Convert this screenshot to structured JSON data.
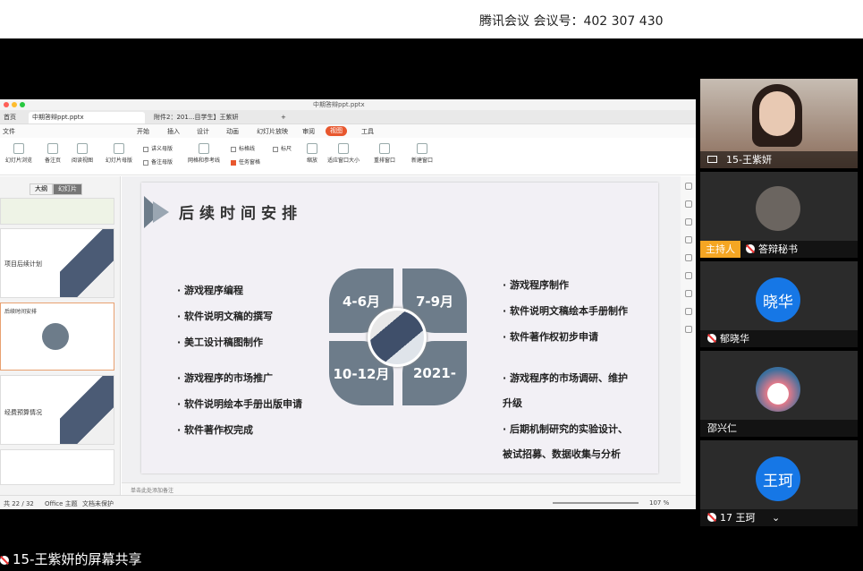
{
  "meeting": {
    "info": "腾讯会议 会议号：402 307 430"
  },
  "window": {
    "filename": "中期答辩ppt.pptx"
  },
  "tabs": [
    {
      "label": "首页"
    },
    {
      "label": "中期答辩ppt.pptx"
    },
    {
      "label": "附件2：201...目学生】王紫妍"
    }
  ],
  "menus": [
    "文件",
    "开始",
    "插入",
    "设计",
    "动画",
    "幻灯片放映",
    "审阅",
    "视图",
    "工具"
  ],
  "ribbon": {
    "buttons": [
      "幻灯片浏览",
      "备注页",
      "阅读视图",
      "幻灯片母版",
      "网格和参考线",
      "缩放",
      "适应窗口大小",
      "重排窗口",
      "新建窗口"
    ],
    "checks": [
      "讲义母版",
      "备注母版",
      "标格线",
      "标尺",
      "任务窗格"
    ]
  },
  "thumbs": {
    "tab_outline": "大纲",
    "tab_slides": "幻灯片",
    "items": [
      {
        "title": "项目后续计划"
      },
      {
        "title": "后续时间安排"
      },
      {
        "title": "经费预算情况"
      }
    ]
  },
  "slide": {
    "title": "后续时间安排",
    "left_bullets": [
      "· 游戏程序编程",
      "· 软件说明文稿的撰写",
      "· 美工设计稿图制作",
      "· 游戏程序的市场推广",
      "· 软件说明绘本手册出版申请",
      "· 软件著作权完成"
    ],
    "right_bullets": [
      "· 游戏程序制作",
      "· 软件说明文稿绘本手册制作",
      "· 软件著作权初步申请",
      "· 游戏程序的市场调研、维护",
      "升级",
      "· 后期机制研究的实验设计、",
      "被试招募、数据收集与分析"
    ],
    "petals": [
      "4-6月",
      "7-9月",
      "10-12月",
      "2021-"
    ]
  },
  "notes": {
    "placeholder": "单击此处添加备注"
  },
  "status": {
    "page": "共 22 / 32",
    "theme": "Office 主题",
    "protect": "文档未保护",
    "zoom": "107 %"
  },
  "participants": [
    {
      "name": "15-王紫妍"
    },
    {
      "name": "答辩秘书",
      "badge": "主持人"
    },
    {
      "name": "郁晓华",
      "avatar_text": "晓华"
    },
    {
      "name": "邵兴仁"
    },
    {
      "name": "17 王珂",
      "avatar_text": "王珂"
    }
  ],
  "share_label": "15-王紫妍的屏幕共享",
  "colors": {
    "accent": "#e8572e",
    "petal": "#6d7c8a",
    "avatar_blue": "#1677e6",
    "host_badge": "#f5a623"
  }
}
